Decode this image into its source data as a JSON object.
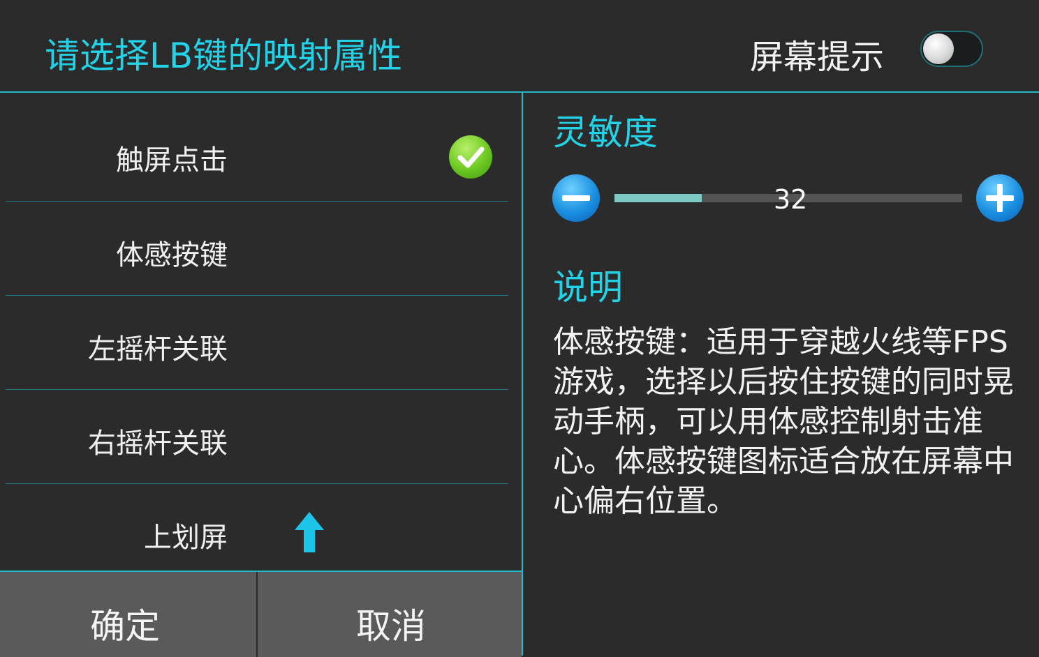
{
  "header": {
    "title": "请选择LB键的映射属性",
    "screen_hint_label": "屏幕提示",
    "screen_hint_toggle": "off"
  },
  "mapping_options": [
    {
      "label": "触屏点击",
      "selected": false
    },
    {
      "label": "体感按键",
      "selected": true
    },
    {
      "label": "左摇杆关联",
      "selected": false
    },
    {
      "label": "右摇杆关联",
      "selected": false
    },
    {
      "label": "上划屏",
      "selected": false
    }
  ],
  "buttons": {
    "confirm": "确定",
    "cancel": "取消"
  },
  "sensitivity": {
    "label": "灵敏度",
    "value": "32",
    "fill_fraction": 0.25
  },
  "description": {
    "label": "说明",
    "text": "体感按键：适用于穿越火线等FPS游戏，选择以后按住按键的同时晃动手柄，可以用体感控制射击准心。体感按键图标适合放在屏幕中心偏右位置。"
  },
  "colors": {
    "accent": "#22d3e8",
    "slider_fill": "#7ec9c3",
    "check": "#6cc820",
    "round_button": "#1a8fe0"
  },
  "icons": {
    "check": "check-circle-icon",
    "up_arrow": "up-arrow-icon",
    "minus": "minus-icon",
    "plus": "plus-icon"
  }
}
